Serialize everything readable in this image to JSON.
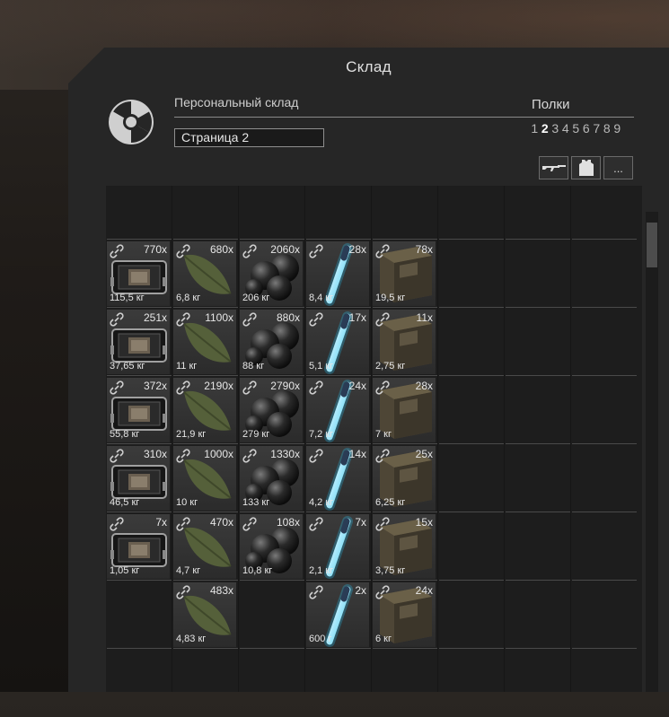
{
  "window": {
    "title": "Склад"
  },
  "storage": {
    "subtitle": "Персональный склад",
    "page_value": "Страница 2",
    "shelves_label": "Полки",
    "shelves": [
      "1",
      "2",
      "3",
      "4",
      "5",
      "6",
      "7",
      "8",
      "9"
    ],
    "active_shelf": "2"
  },
  "filters": [
    {
      "icon": "rifle-icon"
    },
    {
      "icon": "armor-icon"
    },
    {
      "icon": "more-icon",
      "label": "..."
    }
  ],
  "grid": {
    "rows": [
      {
        "cells": [
          null,
          null,
          null,
          null,
          null
        ]
      },
      {
        "cells": [
          {
            "type": "crate",
            "count": "770x",
            "weight": "115,5 кг"
          },
          {
            "type": "leaf",
            "count": "680x",
            "weight": "6,8 кг"
          },
          {
            "type": "orbs",
            "count": "2060x",
            "weight": "206 кг"
          },
          {
            "type": "rod",
            "count": "28x",
            "weight": "8,4 кг"
          },
          {
            "type": "box",
            "count": "78x",
            "weight": "19,5 кг"
          }
        ]
      },
      {
        "cells": [
          {
            "type": "crate",
            "count": "251x",
            "weight": "37,65 кг"
          },
          {
            "type": "leaf",
            "count": "1100x",
            "weight": "11 кг"
          },
          {
            "type": "orbs",
            "count": "880x",
            "weight": "88 кг"
          },
          {
            "type": "rod",
            "count": "17x",
            "weight": "5,1 кг"
          },
          {
            "type": "box",
            "count": "11x",
            "weight": "2,75 кг"
          }
        ]
      },
      {
        "cells": [
          {
            "type": "crate",
            "count": "372x",
            "weight": "55,8 кг"
          },
          {
            "type": "leaf",
            "count": "2190x",
            "weight": "21,9 кг"
          },
          {
            "type": "orbs",
            "count": "2790x",
            "weight": "279 кг"
          },
          {
            "type": "rod",
            "count": "24x",
            "weight": "7,2 кг"
          },
          {
            "type": "box",
            "count": "28x",
            "weight": "7 кг"
          }
        ]
      },
      {
        "cells": [
          {
            "type": "crate",
            "count": "310x",
            "weight": "46,5 кг"
          },
          {
            "type": "leaf",
            "count": "1000x",
            "weight": "10 кг"
          },
          {
            "type": "orbs",
            "count": "1330x",
            "weight": "133 кг"
          },
          {
            "type": "rod",
            "count": "14x",
            "weight": "4,2 кг"
          },
          {
            "type": "box",
            "count": "25x",
            "weight": "6,25 кг"
          }
        ]
      },
      {
        "cells": [
          {
            "type": "crate",
            "count": "7x",
            "weight": "1,05 кг"
          },
          {
            "type": "leaf",
            "count": "470x",
            "weight": "4,7 кг"
          },
          {
            "type": "orbs",
            "count": "108x",
            "weight": "10,8 кг"
          },
          {
            "type": "rod",
            "count": "7x",
            "weight": "2,1 кг"
          },
          {
            "type": "box",
            "count": "15x",
            "weight": "3,75 кг"
          }
        ]
      },
      {
        "cells": [
          null,
          {
            "type": "leaf",
            "count": "483x",
            "weight": "4,83 кг"
          },
          null,
          {
            "type": "rod",
            "count": "2x",
            "weight": "600 г"
          },
          {
            "type": "box",
            "count": "24x",
            "weight": "6 кг"
          }
        ]
      }
    ]
  }
}
